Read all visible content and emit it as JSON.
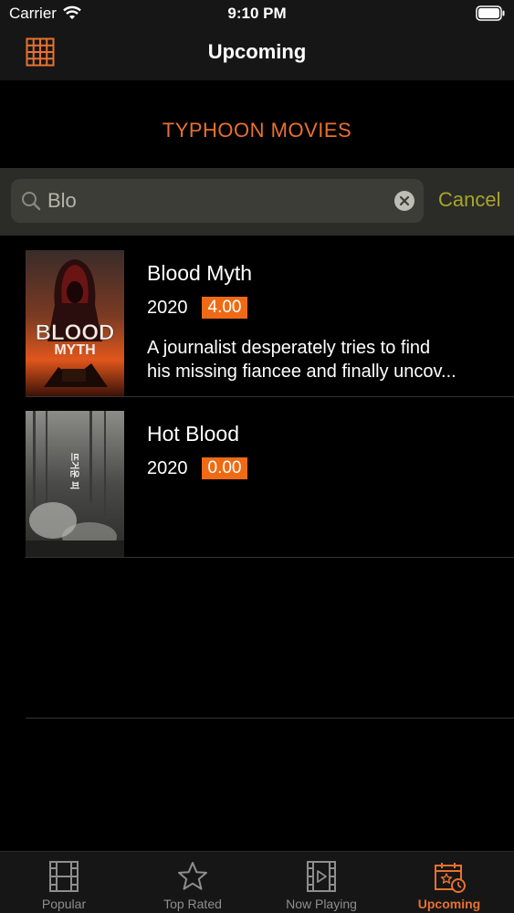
{
  "status_bar": {
    "carrier": "Carrier",
    "time": "9:10 PM"
  },
  "nav": {
    "title": "Upcoming",
    "left_icon": "grid-icon"
  },
  "brand": {
    "title": "TYPHOON MOVIES",
    "color": "#e8712f"
  },
  "search": {
    "value": "Blo",
    "cancel_label": "Cancel",
    "cancel_color": "#a8a52a"
  },
  "movies": [
    {
      "title": "Blood Myth",
      "year": "2020",
      "rating": "4.00",
      "poster_text_1": "BLOOD",
      "poster_text_2": "MYTH",
      "overview_line_1": "A journalist desperately tries to find",
      "overview_line_2": "his missing fiancee and finally uncov..."
    },
    {
      "title": "Hot Blood",
      "year": "2020",
      "rating": "0.00",
      "poster_text_1": "뜨거운 피"
    }
  ],
  "tabs": [
    {
      "label": "Popular",
      "icon": "film-icon",
      "active": false
    },
    {
      "label": "Top Rated",
      "icon": "star-icon",
      "active": false
    },
    {
      "label": "Now Playing",
      "icon": "play-film-icon",
      "active": false
    },
    {
      "label": "Upcoming",
      "icon": "calendar-icon",
      "active": true
    }
  ],
  "colors": {
    "accent": "#e8712f",
    "badge": "#ef6a14",
    "background": "#000000",
    "bar": "#161616"
  }
}
